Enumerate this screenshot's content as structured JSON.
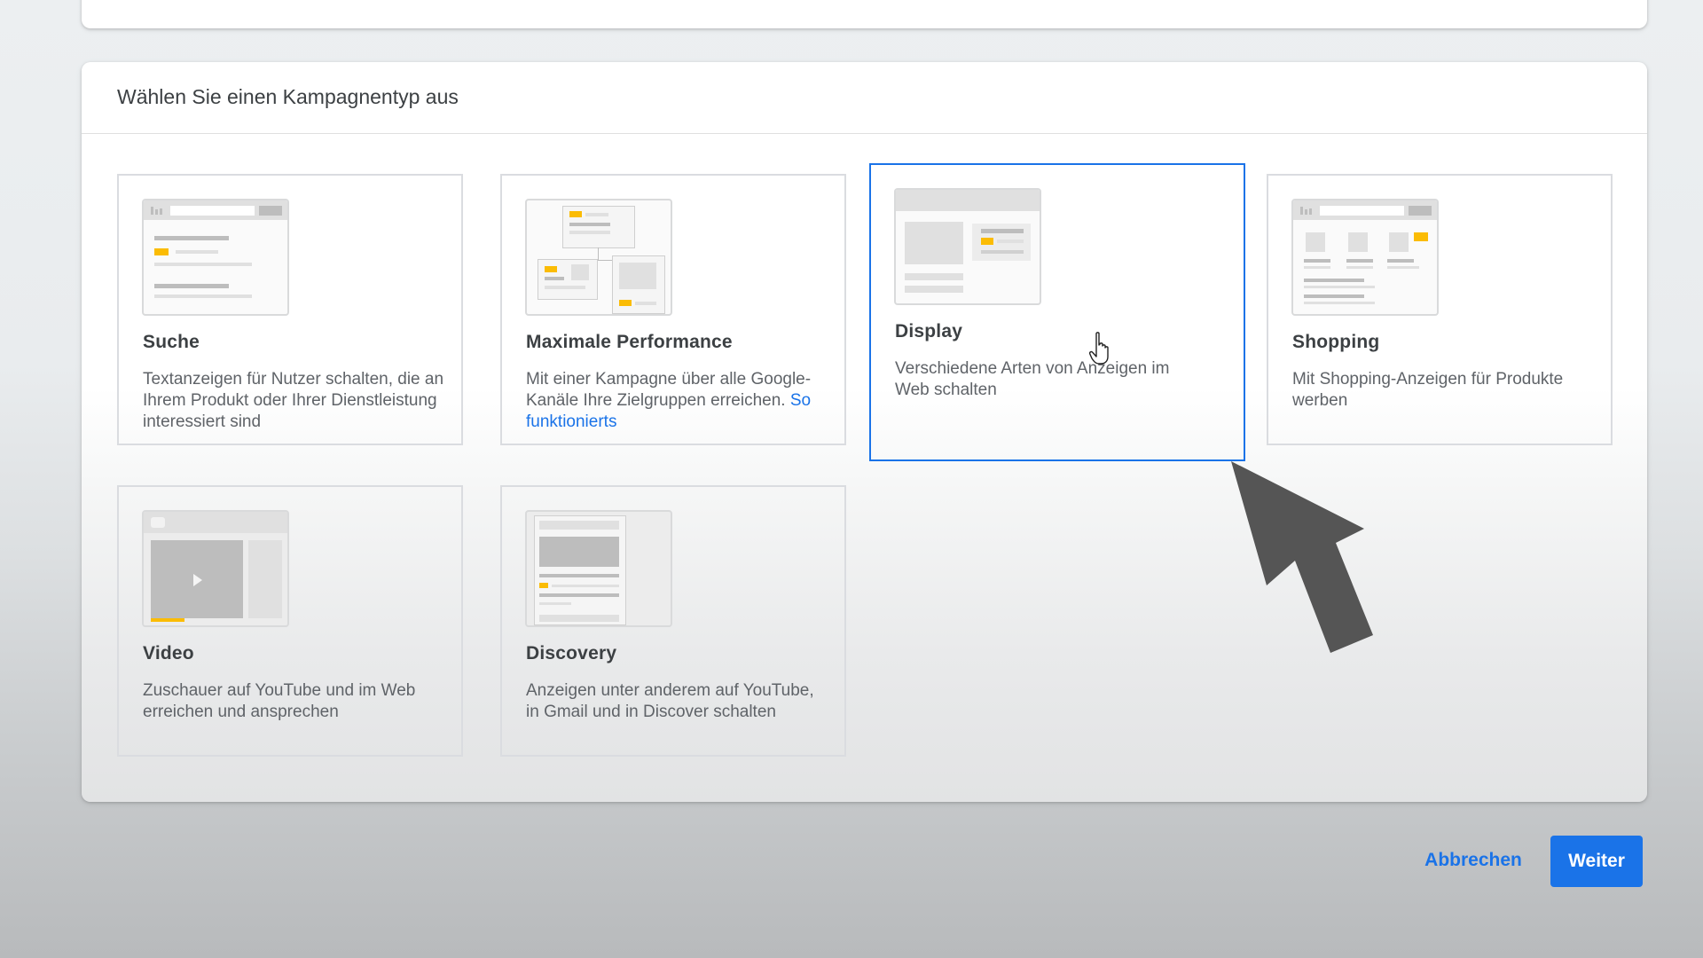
{
  "dialog": {
    "title": "Wählen Sie einen Kampagnentyp aus"
  },
  "campaign_types": [
    {
      "title": "Suche",
      "description": "Textanzeigen für Nutzer schalten, die an Ihrem Produkt oder Ihrer Dienstleistung interessiert sind",
      "icon": "search-campaign-icon",
      "selected": false
    },
    {
      "title": "Maximale Performance",
      "description": "Mit einer Kampagne über alle Google-Kanäle Ihre Zielgruppen erreichen.",
      "link": "So funktionierts",
      "icon": "performance-max-campaign-icon",
      "selected": false
    },
    {
      "title": "Display",
      "description": "Verschiedene Arten von Anzeigen im Web schalten",
      "icon": "display-campaign-icon",
      "selected": true
    },
    {
      "title": "Shopping",
      "description": "Mit Shopping-Anzeigen für Produkte werben",
      "icon": "shopping-campaign-icon",
      "selected": false
    },
    {
      "title": "Video",
      "description": "Zuschauer auf YouTube und im Web erreichen und ansprechen",
      "icon": "video-campaign-icon",
      "selected": false
    },
    {
      "title": "Discovery",
      "description": "Anzeigen unter anderem auf YouTube, in Gmail und in Discover schalten",
      "icon": "discovery-campaign-icon",
      "selected": false
    }
  ],
  "footer": {
    "cancel_label": "Abbrechen",
    "next_label": "Weiter"
  },
  "colors": {
    "accent": "#1a73e8",
    "highlight": "#fbbc04",
    "overlay_arrow": "#555555"
  }
}
